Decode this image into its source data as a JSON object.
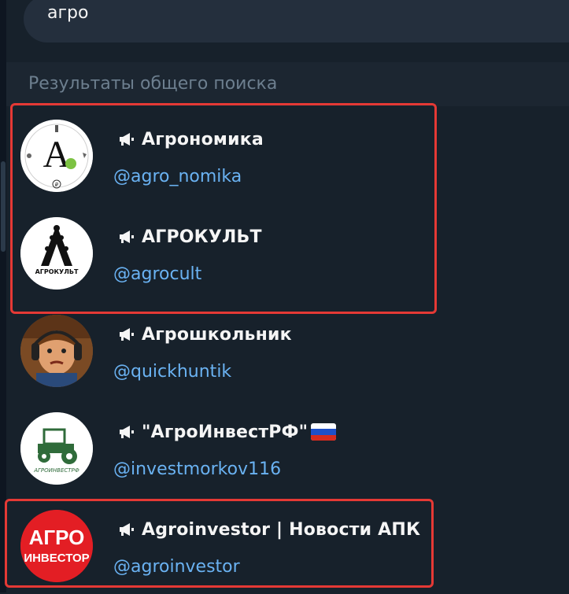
{
  "search": {
    "query": "агро"
  },
  "section": {
    "title": "Результаты общего поиска"
  },
  "results": [
    {
      "name": "Агрономика",
      "handle": "@agro_nomika"
    },
    {
      "name": "АГРОКУЛЬТ",
      "handle": "@agrocult"
    },
    {
      "name": "Агрошкольник",
      "handle": "@quickhuntik"
    },
    {
      "name": "\"АгроИнвестРФ\"",
      "handle": "@investmorkov116"
    },
    {
      "name": "Agroinvestor | Новости АПК",
      "handle": "@agroinvestor"
    }
  ],
  "logos": {
    "agronomika": {
      "letter": "A",
      "sub": "₽"
    },
    "agrocult": {
      "letter": "A",
      "text": "АГРОКУЛЬТ"
    },
    "agroinvestrf": {
      "text": "АГРОИНВЕСТРФ"
    },
    "agroinvestor": {
      "line1": "АГРО",
      "line2": "ИНВЕСТОР"
    }
  },
  "colors": {
    "background": "#17212b",
    "search_field": "#242f3d",
    "section_header": "#1c2631",
    "handle": "#6ab2f2",
    "highlight": "#e53935"
  },
  "icons": {
    "channel": "megaphone-icon",
    "search_flag": "russia-flag-icon"
  }
}
